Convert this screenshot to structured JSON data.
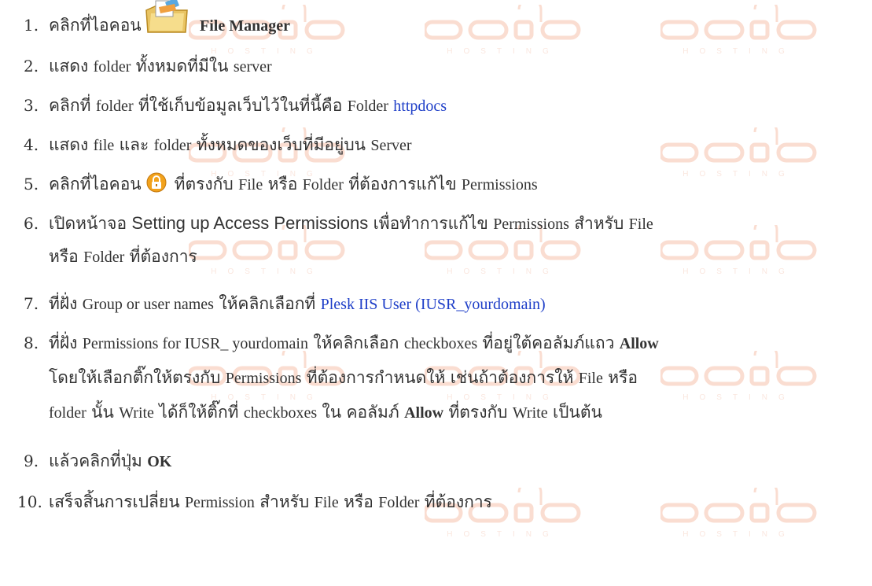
{
  "watermark": {
    "brand": "chai",
    "tagline": "HOSTING"
  },
  "steps": [
    {
      "num": "1.",
      "parts": [
        "คลิกที่ไอคอน",
        "File Manager"
      ],
      "icon": "file-manager-icon"
    },
    {
      "num": "2.",
      "parts": [
        "แสดง",
        "folder",
        "ทั้งหมดที่มีใน",
        "server"
      ]
    },
    {
      "num": "3.",
      "parts": [
        "คลิกที่",
        "folder",
        "ที่ใช้เก็บข้อมูลเว็บไว้ในที่นี้คือ",
        "Folder",
        "httpdocs"
      ]
    },
    {
      "num": "4.",
      "parts": [
        "แสดง",
        "file",
        "และ",
        "folder",
        "ทั้งหมดของเว็บที่มีอยู่บน",
        "Server"
      ]
    },
    {
      "num": "5.",
      "parts": [
        "คลิกที่ไอคอน",
        "ที่ตรงกับ",
        "File",
        "หรือ",
        "Folder",
        "ที่ต้องการแก้ไข",
        "Permissions"
      ],
      "icon": "lock-icon"
    },
    {
      "num": "6.",
      "parts": [
        "เปิดหน้าจอ",
        "Setting up Access Permissions",
        "เพื่อทำการแก้ไข",
        "Permissions",
        "สำหรับ",
        "File",
        "หรือ",
        "Folder",
        "ที่ต้องการ"
      ]
    },
    {
      "num": "7.",
      "parts": [
        "ที่ฝั่ง",
        "Group or user names",
        "ให้คลิกเลือกที่",
        "Plesk IIS User (IUSR_yourdomain)"
      ]
    },
    {
      "num": "8.",
      "parts": [
        "ที่ฝั่ง",
        "Permissions for IUSR_ yourdomain",
        "ให้คลิกเลือก",
        "checkboxes",
        "ที่อยู่ใต้คอลัมภ์แถว",
        "Allow",
        "โดยให้เลือกติ๊กให้ตรงกับ",
        "Permissions",
        "ที่ต้องการกำหนดให้",
        "เช่นถ้าต้องการให้",
        "File",
        "หรือ",
        "folder",
        "นั้น",
        "Write",
        "ได้ก็ให้ติ๊กที่",
        "checkboxes",
        "ใน",
        "คอลัมภ์",
        "Allow",
        "ที่ตรงกับ",
        "Write",
        "เป็นต้น"
      ]
    },
    {
      "num": "9.",
      "parts": [
        "แล้วคลิกที่ปุ่ม",
        "OK"
      ]
    },
    {
      "num": "10.",
      "parts": [
        "เสร็จสิ้นการเปลี่ยน",
        "Permission",
        "สำหรับ",
        "File",
        "หรือ",
        "Folder",
        "ที่ต้องการ"
      ]
    }
  ]
}
